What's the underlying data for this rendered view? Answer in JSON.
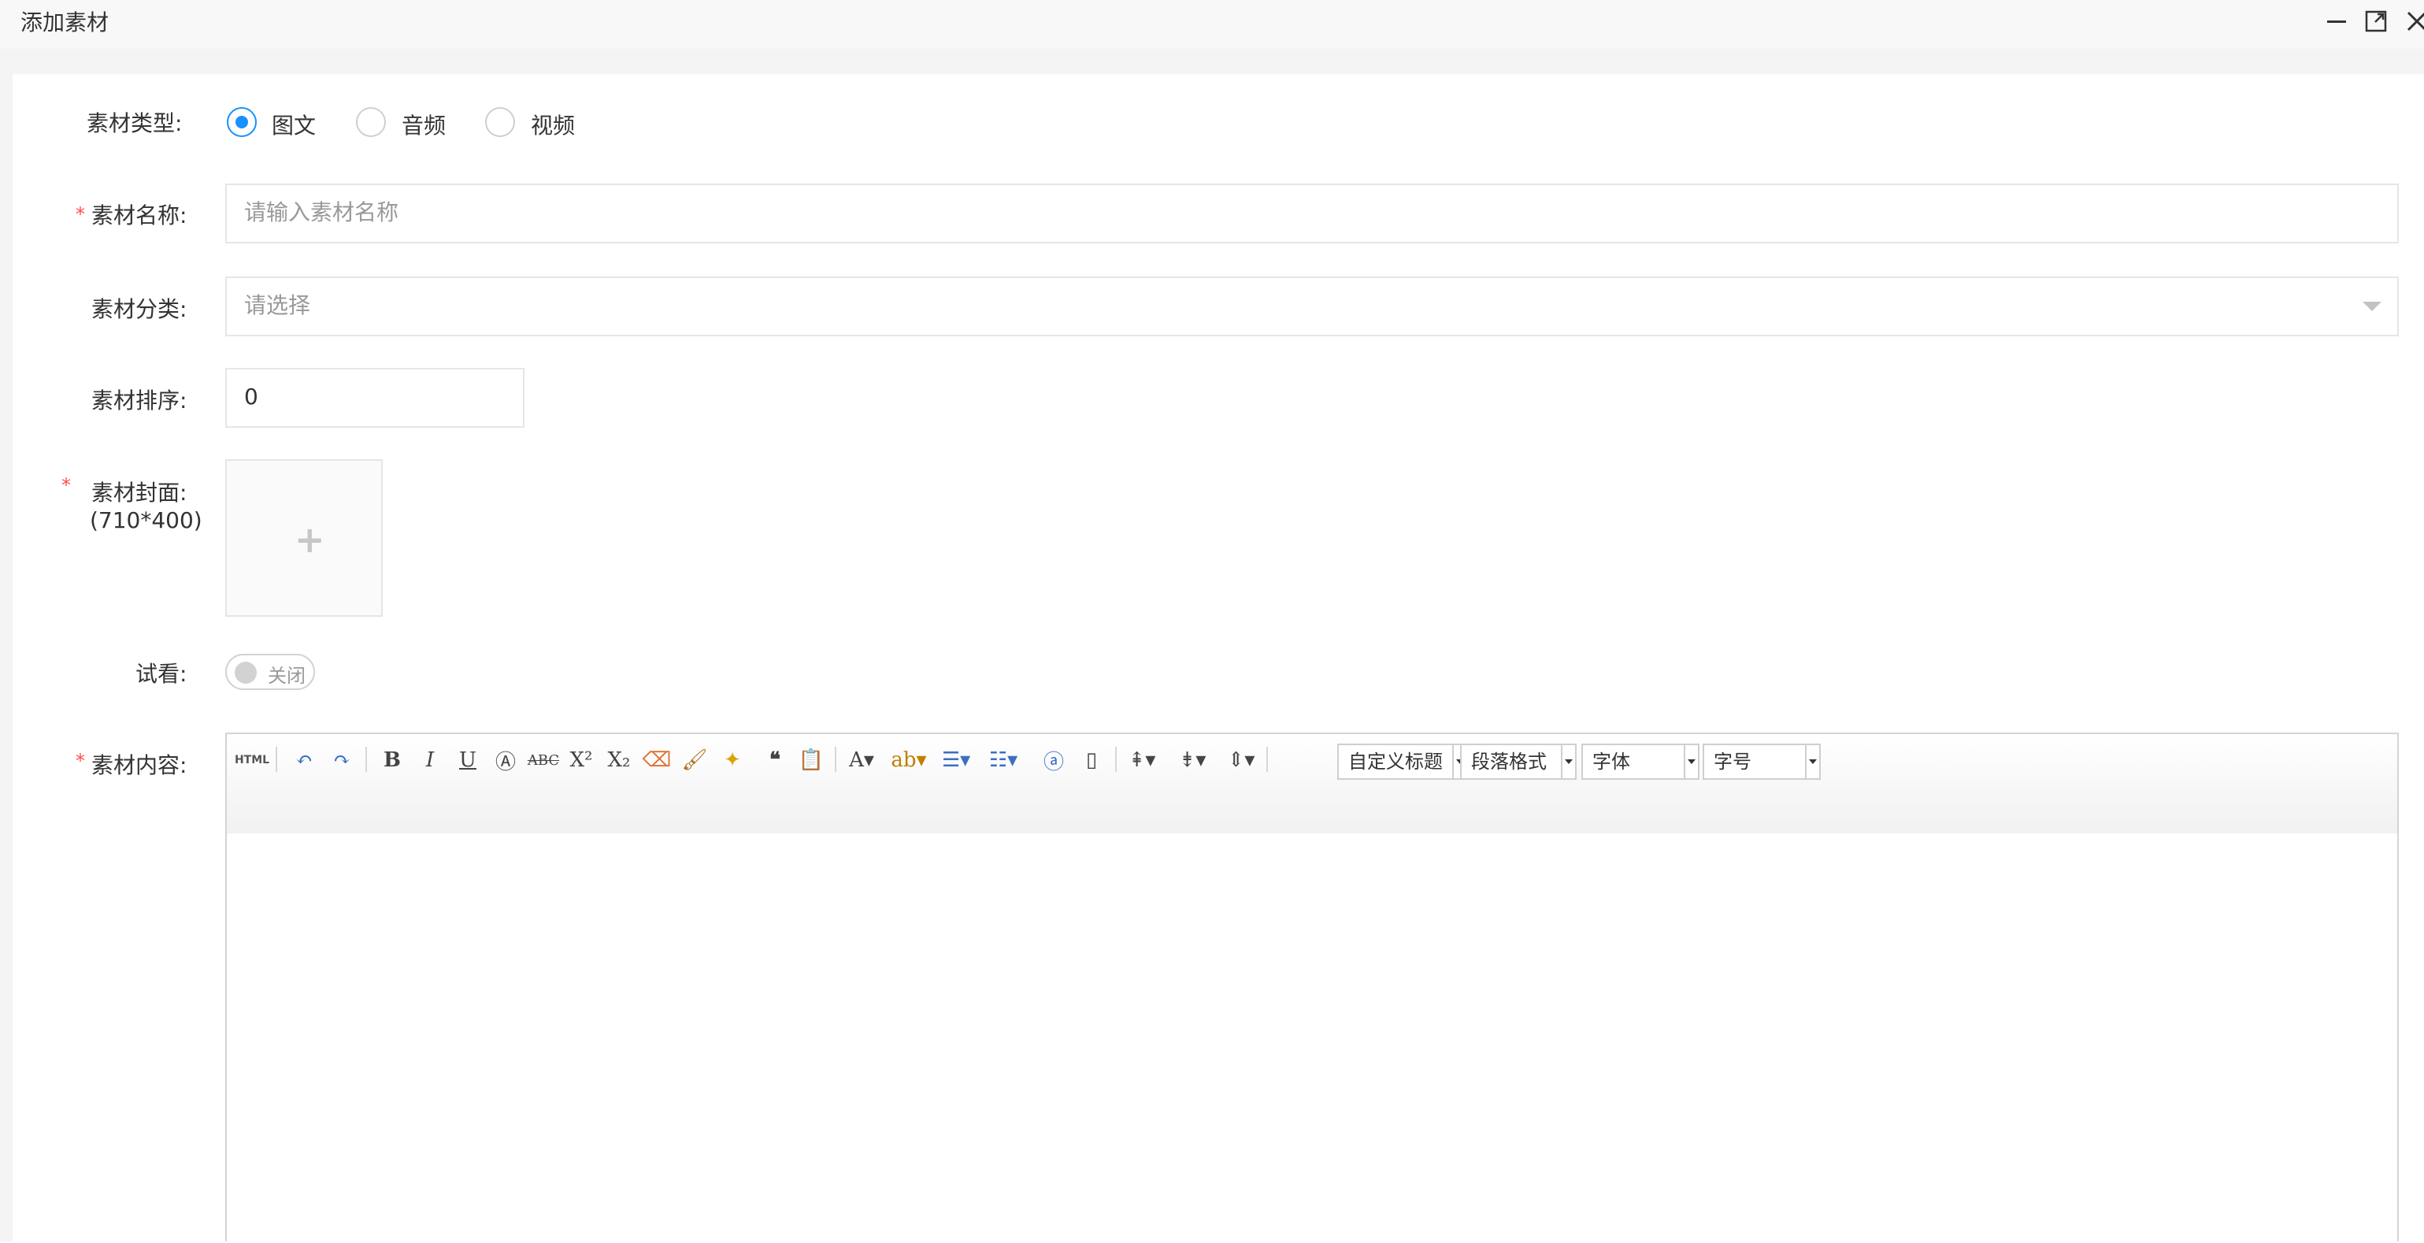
{
  "window": {
    "title": "添加素材"
  },
  "form": {
    "type_label": "素材类型:",
    "type_options": [
      "图文",
      "音频",
      "视频"
    ],
    "type_selected": "图文",
    "name_label": "素材名称:",
    "name_placeholder": "请输入素材名称",
    "category_label": "素材分类:",
    "category_value": "请选择",
    "sort_label": "素材排序:",
    "sort_value": "0",
    "cover_label": "素材封面:",
    "cover_size": "(710*400)",
    "trial_label": "试看:",
    "trial_state": "关闭",
    "content_label": "素材内容:",
    "required_mark": "*"
  },
  "editor": {
    "html_button": "HTML",
    "heading_combo": "自定义标题",
    "paragraph_combo": "段落格式",
    "font_combo": "字体",
    "size_combo": "字号"
  },
  "colors": {
    "accent": "#1890ff",
    "required": "#ff4d4f",
    "border": "#e6e6e6"
  }
}
